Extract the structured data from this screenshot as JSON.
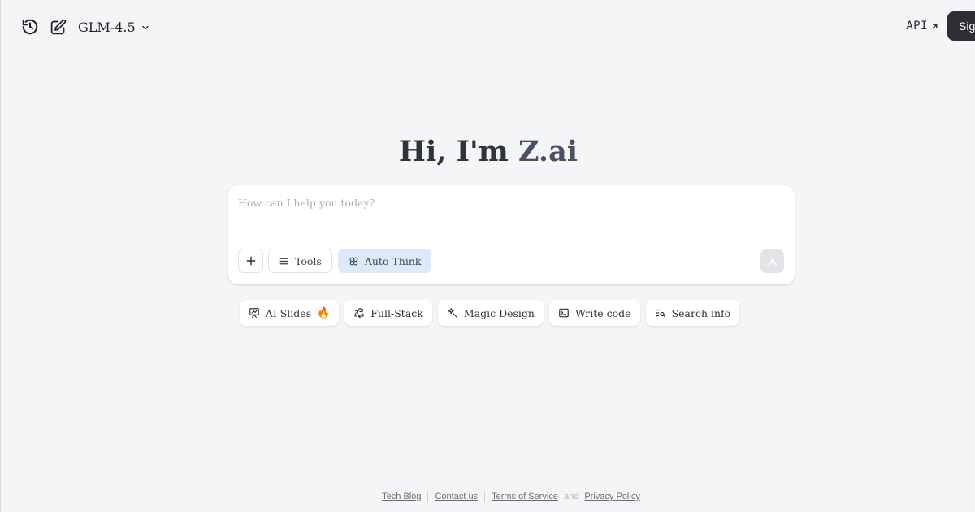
{
  "header": {
    "model_name": "GLM-4.5",
    "api_label": "API",
    "signin_label": "Sign in"
  },
  "hero": {
    "greeting": "Hi, I'm",
    "brand": "Z.ai"
  },
  "chat": {
    "placeholder": "How can I help you today?",
    "tools_label": "Tools",
    "auto_think_label": "Auto Think"
  },
  "suggestions": [
    {
      "label": "AI Slides",
      "emoji": "🔥",
      "icon": "presentation-icon"
    },
    {
      "label": "Full-Stack",
      "icon": "recycle-icon"
    },
    {
      "label": "Magic Design",
      "icon": "magic-wand-icon"
    },
    {
      "label": "Write code",
      "icon": "terminal-icon"
    },
    {
      "label": "Search info",
      "icon": "search-list-icon"
    }
  ],
  "footer": {
    "links": [
      "Tech Blog",
      "Contact us",
      "Terms of Service",
      "Privacy Policy"
    ],
    "and": "and"
  },
  "colors": {
    "background": "#f4f5f7",
    "accent_active": "#dbe9fb",
    "signin_bg": "#2d2f34",
    "brand_text": "#4b5162"
  }
}
